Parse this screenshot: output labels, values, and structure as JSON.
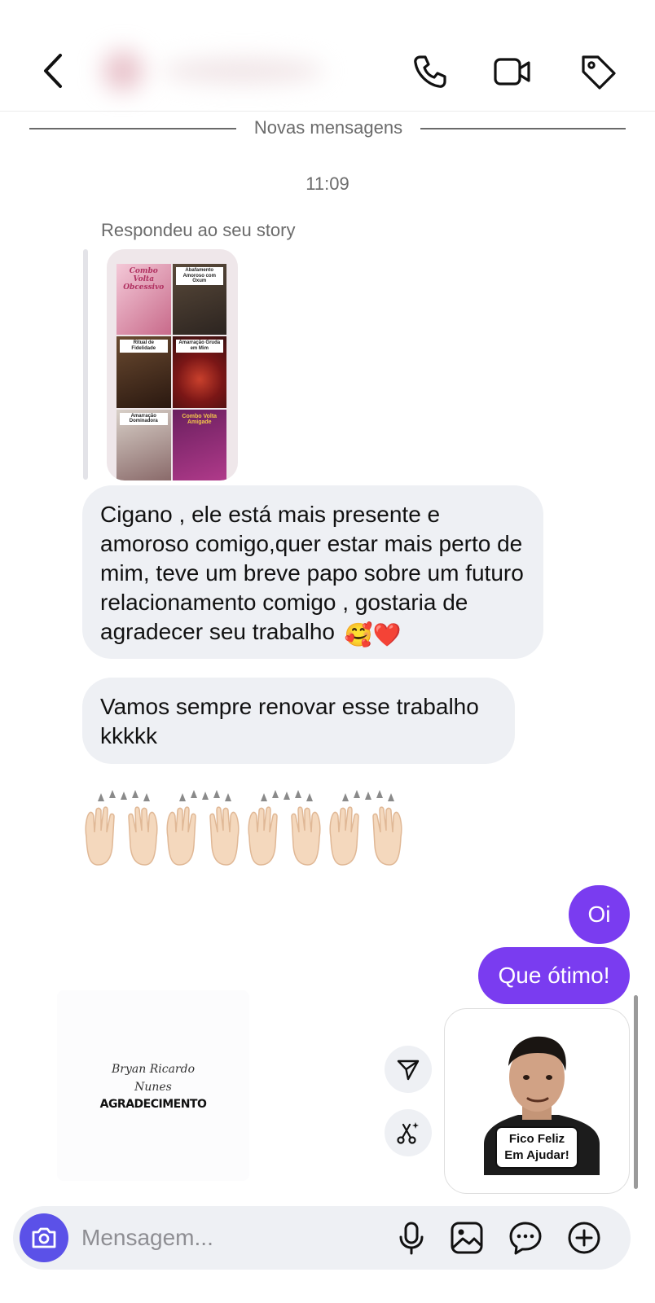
{
  "divider": {
    "text": "Novas mensagens"
  },
  "conversation": {
    "timestamp": "11:09",
    "reply_caption": "Respondeu ao seu story",
    "story": {
      "tiles": [
        {
          "caption": "Combo Volta Obcessivo"
        },
        {
          "caption": "Abafamento Amoroso com Oxum"
        },
        {
          "caption": "Ritual de Fidelidade"
        },
        {
          "caption": "Amarração Gruda em Mim"
        },
        {
          "caption": "Amarração Dominadora"
        },
        {
          "caption": "Combo Volta Amigade"
        }
      ]
    },
    "incoming": [
      {
        "text": "Cigano , ele está mais presente e amoroso comigo,quer estar mais perto de mim, teve um breve papo sobre um futuro relacionamento comigo , gostaria de agradecer seu trabalho",
        "emoji": "🥰❤️"
      },
      {
        "text": "Vamos sempre renovar esse trabalho kkkkk"
      }
    ],
    "emoji_reaction": {
      "icon": "raising-hands-emoji",
      "count": 4
    },
    "outgoing": [
      {
        "text": "Oi"
      },
      {
        "text": "Que ótimo!"
      }
    ],
    "thanks_card": {
      "name_line1": "Bryan Ricardo",
      "name_line2": "Nunes",
      "title": "AGRADECIMENTO"
    },
    "sticker": {
      "caption_line1": "Fico Feliz",
      "caption_line2": "Em Ajudar!"
    }
  },
  "composer": {
    "placeholder": "Mensagem..."
  },
  "colors": {
    "accent": "#7a3cf0",
    "camera": "#5b51e8",
    "incoming_bubble": "#eef0f4",
    "muted_text": "#6b6b6b"
  },
  "icons": {
    "header": [
      "back-arrow-icon",
      "phone-icon",
      "video-icon",
      "tag-icon"
    ],
    "actions": [
      "share-icon",
      "magic-edit-icon"
    ],
    "composer": [
      "camera-icon",
      "microphone-icon",
      "gallery-icon",
      "sticker-icon",
      "plus-icon"
    ]
  }
}
